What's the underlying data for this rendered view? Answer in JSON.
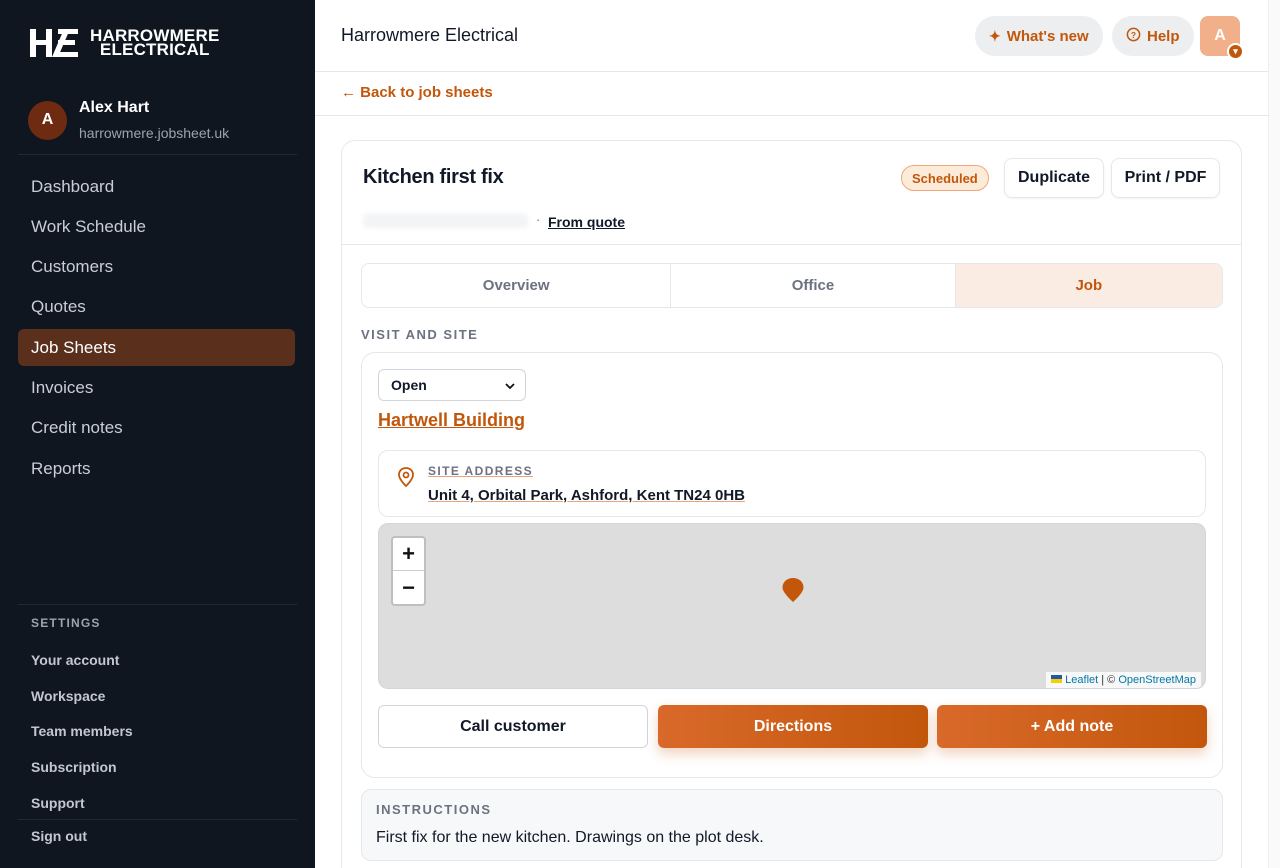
{
  "brand": {
    "line1": "HARROWMERE",
    "line2": "ELECTRICAL"
  },
  "user": {
    "initial": "A",
    "name": "Alex Hart",
    "domain": "harrowmere.jobsheet.uk"
  },
  "nav": [
    {
      "label": "Dashboard",
      "active": false
    },
    {
      "label": "Work Schedule",
      "active": false
    },
    {
      "label": "Customers",
      "active": false
    },
    {
      "label": "Quotes",
      "active": false
    },
    {
      "label": "Job Sheets",
      "active": true
    },
    {
      "label": "Invoices",
      "active": false
    },
    {
      "label": "Credit notes",
      "active": false
    },
    {
      "label": "Reports",
      "active": false
    }
  ],
  "settings": {
    "label": "SETTINGS",
    "items": [
      "Your account",
      "Workspace",
      "Team members",
      "Subscription",
      "Support"
    ],
    "signout": "Sign out"
  },
  "topbar": {
    "title": "Harrowmere Electrical",
    "whats_new": "What's new",
    "help": "Help",
    "avatar_initial": "A"
  },
  "back_link": "← Back to job sheets",
  "job": {
    "title": "Kitchen first fix",
    "separator": "·",
    "from_quote": "From quote",
    "status": "Scheduled",
    "duplicate": "Duplicate",
    "print": "Print / PDF"
  },
  "tabs": [
    {
      "label": "Overview",
      "active": false
    },
    {
      "label": "Office",
      "active": false
    },
    {
      "label": "Job",
      "active": true
    }
  ],
  "visit": {
    "section_label": "VISIT AND SITE",
    "status_value": "Open",
    "site_name": "Hartwell Building",
    "address_label": "SITE ADDRESS",
    "address": "Unit 4, Orbital Park, Ashford, Kent TN24 0HB",
    "map": {
      "zoom_in": "+",
      "zoom_out": "−",
      "attribution_leaflet": "Leaflet",
      "attribution_sep": "| ©",
      "attribution_osm": "OpenStreetMap"
    },
    "call_customer": "Call customer",
    "directions": "Directions",
    "add_note": "+ Add note"
  },
  "instructions": {
    "label": "INSTRUCTIONS",
    "text": "First fix for the new kitchen. Drawings on the plot desk."
  },
  "colors": {
    "accent": "#c2570c",
    "sidebar_bg": "#0f1620",
    "active_nav": "#5a301d"
  }
}
